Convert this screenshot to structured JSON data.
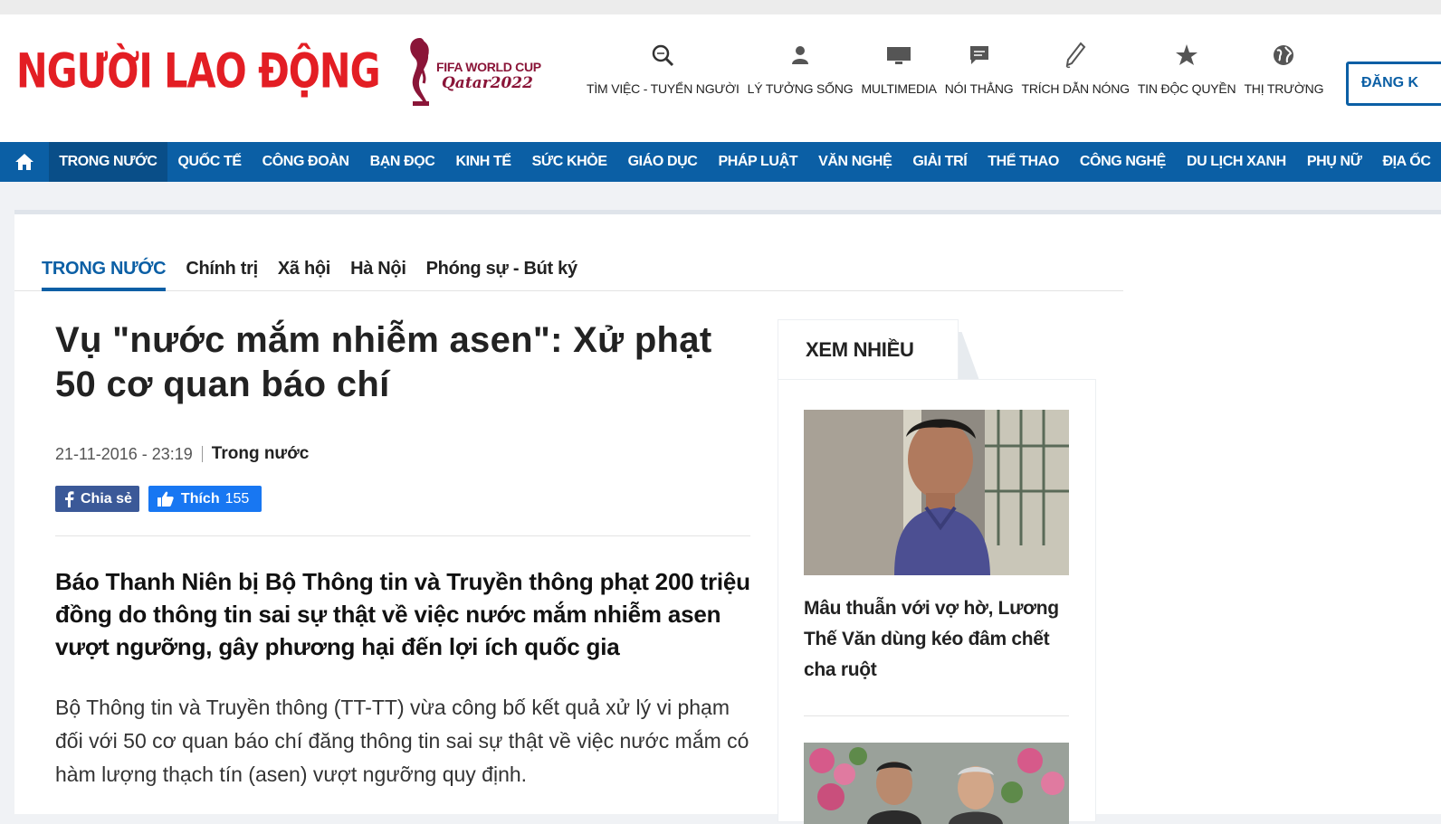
{
  "site": {
    "logo_text": "NGƯỜI LAO ĐỘNG",
    "fifa_line1": "FIFA WORLD CUP",
    "fifa_line2": "Qatar2022",
    "login_label": "ĐĂNG K"
  },
  "quicklinks": [
    {
      "label": "TÌM VIỆC - TUYỂN NGƯỜI",
      "icon": "search-icon"
    },
    {
      "label": "LÝ TƯỞNG SỐNG",
      "icon": "person-icon"
    },
    {
      "label": "MULTIMEDIA",
      "icon": "monitor-icon"
    },
    {
      "label": "NÓI THẲNG",
      "icon": "chat-icon"
    },
    {
      "label": "TRÍCH DẪN NÓNG",
      "icon": "pen-icon"
    },
    {
      "label": "TIN ĐỘC QUYỀN",
      "icon": "star-icon"
    },
    {
      "label": "THỊ TRƯỜNG",
      "icon": "globe-icon"
    }
  ],
  "nav": {
    "items": [
      "TRONG NƯỚC",
      "QUỐC TẾ",
      "CÔNG ĐOÀN",
      "BẠN ĐỌC",
      "KINH TẾ",
      "SỨC KHỎE",
      "GIÁO DỤC",
      "PHÁP LUẬT",
      "VĂN NGHỆ",
      "GIẢI TRÍ",
      "THỂ THAO",
      "CÔNG NGHỆ",
      "DU LỊCH XANH",
      "PHỤ NỮ",
      "ĐỊA ỐC"
    ],
    "active_index": 0
  },
  "subnav": {
    "items": [
      "TRONG NƯỚC",
      "Chính trị",
      "Xã hội",
      "Hà Nội",
      "Phóng sự - Bút ký"
    ],
    "active_index": 0
  },
  "article": {
    "title": "Vụ \"nước mắm nhiễm asen\": Xử phạt 50 cơ quan báo chí",
    "date": "21-11-2016 - 23:19",
    "category": "Trong nước",
    "share_label": "Chia sẻ",
    "like_label": "Thích",
    "like_count": "155",
    "lead": "Báo Thanh Niên bị Bộ Thông tin và Truyền thông phạt 200 triệu đồng do thông tin sai sự thật về việc nước mắm nhiễm asen vượt ngưỡng, gây phương hại đến lợi ích quốc gia",
    "body": "Bộ Thông tin và Truyền thông (TT-TT) vừa công bố kết quả xử lý vi phạm đối với 50 cơ quan báo chí đăng thông tin sai sự thật về việc nước mắm có hàm lượng thạch tín (asen) vượt ngưỡng quy định."
  },
  "sidebar": {
    "title": "XEM NHIỀU",
    "items": [
      {
        "headline": "Mâu thuẫn với vợ hờ, Lương Thế Văn dùng kéo đâm chết cha ruột"
      }
    ]
  },
  "colors": {
    "brand_red": "#e31e24",
    "nav_blue": "#0b5fa5",
    "facebook": "#3b5998",
    "like": "#1877f2"
  }
}
